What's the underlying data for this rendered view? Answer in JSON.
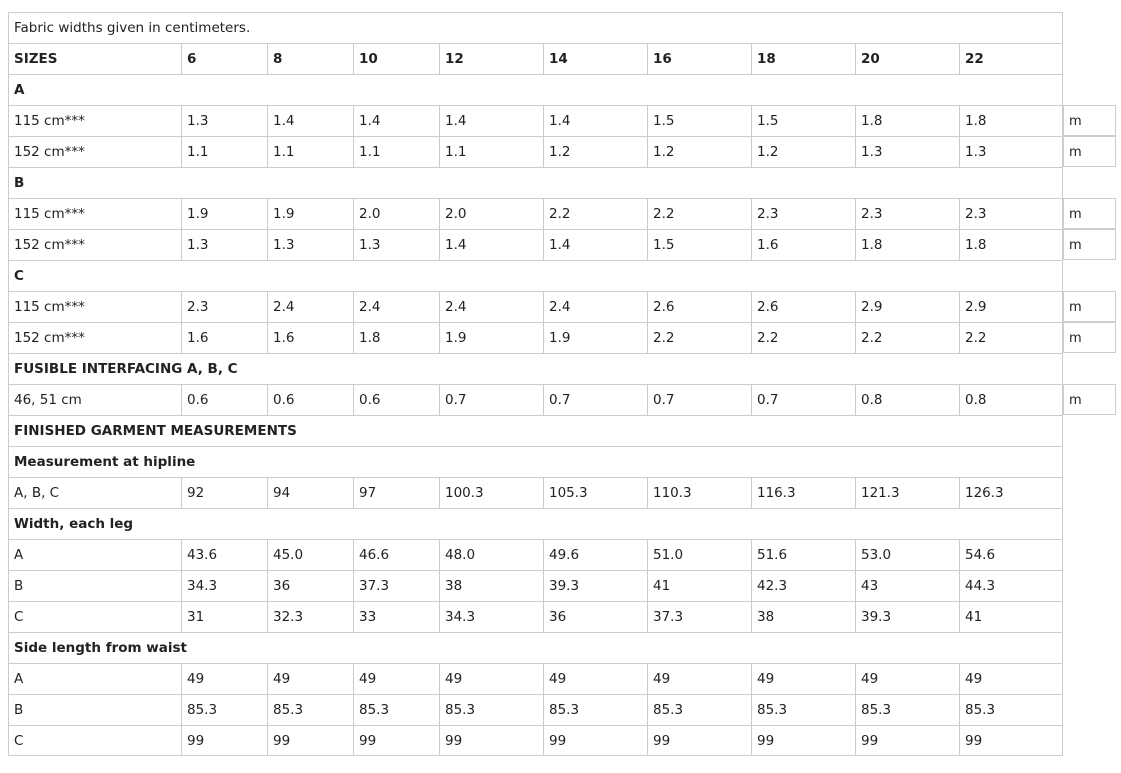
{
  "note": "Fabric widths given in centimeters.",
  "header": {
    "label": "SIZES",
    "sizes": [
      "6",
      "8",
      "10",
      "12",
      "14",
      "16",
      "18",
      "20",
      "22"
    ]
  },
  "sections": [
    {
      "title": "A",
      "rows": [
        {
          "label": "115 cm***",
          "values": [
            "1.3",
            "1.4",
            "1.4",
            "1.4",
            "1.4",
            "1.5",
            "1.5",
            "1.8",
            "1.8"
          ],
          "unit": "m"
        },
        {
          "label": "152 cm***",
          "values": [
            "1.1",
            "1.1",
            "1.1",
            "1.1",
            "1.2",
            "1.2",
            "1.2",
            "1.3",
            "1.3"
          ],
          "unit": "m"
        }
      ]
    },
    {
      "title": "B",
      "rows": [
        {
          "label": "115 cm***",
          "values": [
            "1.9",
            "1.9",
            "2.0",
            "2.0",
            "2.2",
            "2.2",
            "2.3",
            "2.3",
            "2.3"
          ],
          "unit": "m"
        },
        {
          "label": "152 cm***",
          "values": [
            "1.3",
            "1.3",
            "1.3",
            "1.4",
            "1.4",
            "1.5",
            "1.6",
            "1.8",
            "1.8"
          ],
          "unit": "m"
        }
      ]
    },
    {
      "title": "C",
      "rows": [
        {
          "label": "115 cm***",
          "values": [
            "2.3",
            "2.4",
            "2.4",
            "2.4",
            "2.4",
            "2.6",
            "2.6",
            "2.9",
            "2.9"
          ],
          "unit": "m"
        },
        {
          "label": "152 cm***",
          "values": [
            "1.6",
            "1.6",
            "1.8",
            "1.9",
            "1.9",
            "2.2",
            "2.2",
            "2.2",
            "2.2"
          ],
          "unit": "m"
        }
      ]
    },
    {
      "title": "FUSIBLE INTERFACING A, B, C",
      "rows": [
        {
          "label": "46, 51 cm",
          "values": [
            "0.6",
            "0.6",
            "0.6",
            "0.7",
            "0.7",
            "0.7",
            "0.7",
            "0.8",
            "0.8"
          ],
          "unit": "m"
        }
      ]
    },
    {
      "title": "FINISHED GARMENT MEASUREMENTS",
      "rows": []
    },
    {
      "title": "Measurement at hipline",
      "rows": [
        {
          "label": "A, B, C",
          "values": [
            "92",
            "94",
            "97",
            "100.3",
            "105.3",
            "110.3",
            "116.3",
            "121.3",
            "126.3"
          ],
          "unit": ""
        }
      ]
    },
    {
      "title": "Width, each leg",
      "rows": [
        {
          "label": "A",
          "values": [
            "43.6",
            "45.0",
            "46.6",
            "48.0",
            "49.6",
            "51.0",
            "51.6",
            "53.0",
            "54.6"
          ],
          "unit": ""
        },
        {
          "label": "B",
          "values": [
            "34.3",
            "36",
            "37.3",
            "38",
            "39.3",
            "41",
            "42.3",
            "43",
            "44.3"
          ],
          "unit": ""
        },
        {
          "label": "C",
          "values": [
            "31",
            "32.3",
            "33",
            "34.3",
            "36",
            "37.3",
            "38",
            "39.3",
            "41"
          ],
          "unit": ""
        }
      ]
    },
    {
      "title": "Side length from waist",
      "rows": [
        {
          "label": "A",
          "values": [
            "49",
            "49",
            "49",
            "49",
            "49",
            "49",
            "49",
            "49",
            "49"
          ],
          "unit": ""
        },
        {
          "label": "B",
          "values": [
            "85.3",
            "85.3",
            "85.3",
            "85.3",
            "85.3",
            "85.3",
            "85.3",
            "85.3",
            "85.3"
          ],
          "unit": ""
        },
        {
          "label": "C",
          "values": [
            "99",
            "99",
            "99",
            "99",
            "99",
            "99",
            "99",
            "99",
            "99"
          ],
          "unit": ""
        }
      ]
    }
  ]
}
